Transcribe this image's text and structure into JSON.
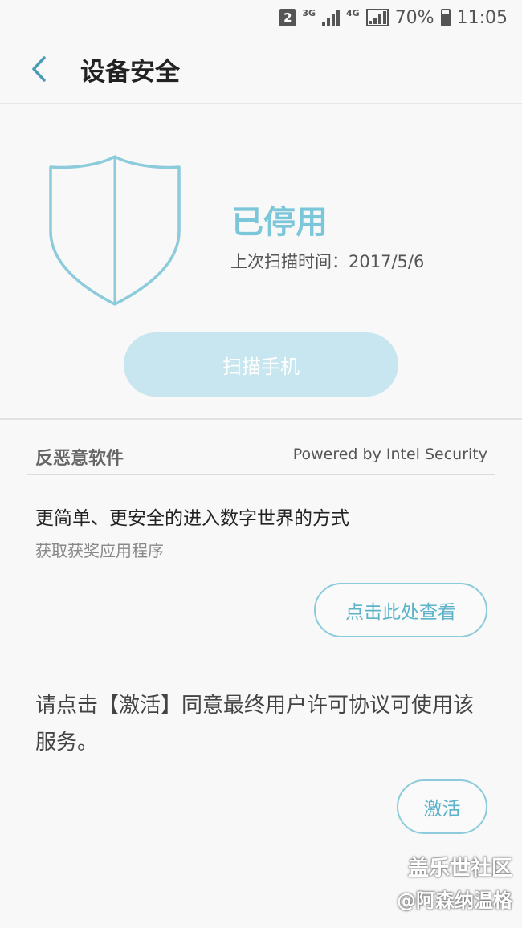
{
  "status_bar": {
    "sim_slot": "2",
    "network_1": "3G",
    "network_2": "4G",
    "battery": "70%",
    "time": "11:05"
  },
  "header": {
    "title": "设备安全",
    "back_icon": "chevron-left-icon"
  },
  "security": {
    "status": "已停用",
    "last_scan": "上次扫描时间：2017/5/6",
    "scan_button": "扫描手机",
    "shield_color": "#7cc6d9"
  },
  "antimalware": {
    "section_title": "反恶意软件",
    "powered_by": "Powered by Intel Security",
    "promo_title": "更简单、更安全的进入数字世界的方式",
    "promo_subtitle": "获取获奖应用程序",
    "view_button": "点击此处查看",
    "activate_text": "请点击【激活】同意最终用户许可协议可使用该服务。",
    "activate_button": "激活"
  },
  "watermark": {
    "line1": "盖乐世社区",
    "line2": "@阿森纳温格"
  }
}
